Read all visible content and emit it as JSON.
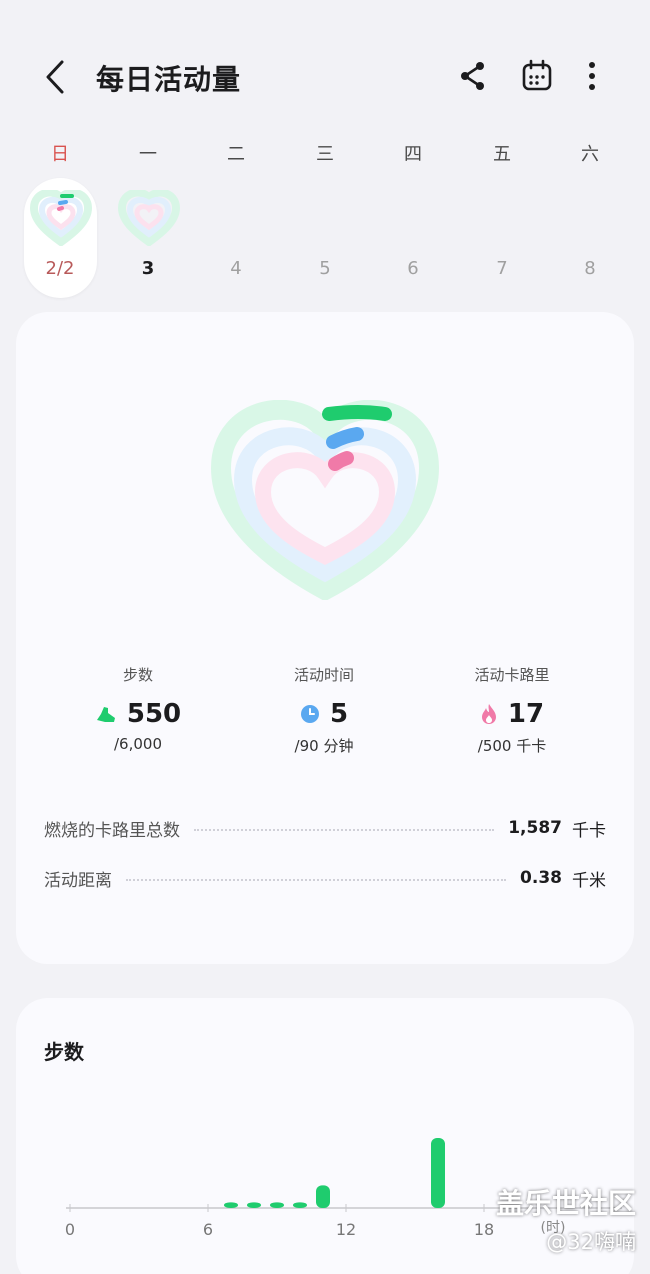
{
  "header": {
    "title": "每日活动量"
  },
  "week": {
    "days": [
      "日",
      "一",
      "二",
      "三",
      "四",
      "五",
      "六"
    ],
    "dates": [
      "2/2",
      "3",
      "4",
      "5",
      "6",
      "7",
      "8"
    ],
    "selected_index": 0
  },
  "stats": {
    "steps": {
      "label": "步数",
      "value": "550",
      "goal": "/6,000",
      "progress": 0.092
    },
    "active_time": {
      "label": "活动时间",
      "value": "5",
      "goal": "/90 分钟",
      "progress": 0.056
    },
    "active_calories": {
      "label": "活动卡路里",
      "value": "17",
      "goal": "/500 千卡",
      "progress": 0.034
    }
  },
  "summary": {
    "burned_label": "燃烧的卡路里总数",
    "burned_value": "1,587",
    "burned_unit": "千卡",
    "distance_label": "活动距离",
    "distance_value": "0.38",
    "distance_unit": "千米"
  },
  "chart_data": {
    "type": "bar",
    "title": "步数",
    "xlabel": "(时)",
    "xlim": [
      0,
      24
    ],
    "x_ticks": [
      "0",
      "6",
      "12",
      "18"
    ],
    "x": [
      7,
      8,
      9,
      10,
      11,
      16
    ],
    "values": [
      5,
      5,
      5,
      5,
      20,
      62
    ],
    "color": "#1fcc6e"
  },
  "watermark": {
    "line1": "盖乐世社区",
    "line2": "@32嗨喃"
  },
  "colors": {
    "steps": "#1fcc6e",
    "time": "#5aa8f0",
    "calories": "#f07aa8",
    "sunday": "#d9534f"
  },
  "icons": {
    "back": "chevron-left-icon",
    "share": "share-icon",
    "calendar": "calendar-icon",
    "more": "more-vertical-icon",
    "steps": "shoe-icon",
    "time": "clock-icon",
    "calories": "flame-icon"
  }
}
